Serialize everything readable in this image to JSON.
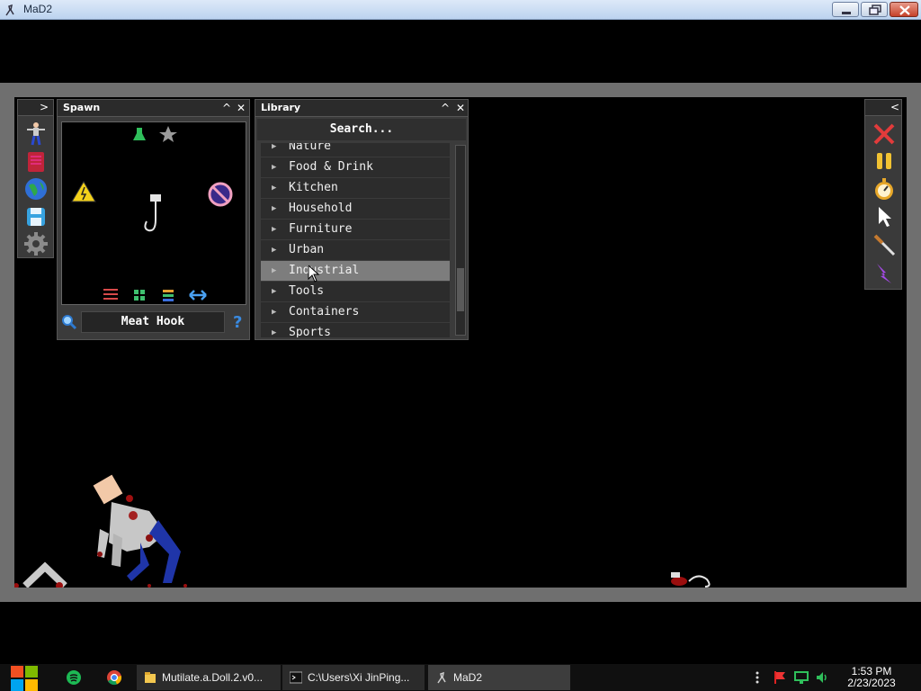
{
  "window": {
    "title": "MaD2"
  },
  "spawn_panel": {
    "title": "Spawn",
    "selected_item": "Meat Hook"
  },
  "library_panel": {
    "title": "Library",
    "search_placeholder": "Search...",
    "categories": [
      {
        "label": "Nature"
      },
      {
        "label": "Food & Drink"
      },
      {
        "label": "Kitchen"
      },
      {
        "label": "Household"
      },
      {
        "label": "Furniture"
      },
      {
        "label": "Urban"
      },
      {
        "label": "Industrial",
        "selected": true
      },
      {
        "label": "Tools"
      },
      {
        "label": "Containers"
      },
      {
        "label": "Sports"
      }
    ]
  },
  "left_toolbar": {
    "icons": [
      "ragdoll-icon",
      "book-icon",
      "globe-icon",
      "save-icon",
      "settings-gear-icon"
    ]
  },
  "right_toolbar": {
    "icons": [
      "clear-x-icon",
      "pause-icon",
      "stopwatch-icon",
      "cursor-icon",
      "knife-icon",
      "lightning-icon"
    ]
  },
  "taskbar": {
    "tasks": [
      {
        "label": "Mutilate.a.Doll.2.v0..."
      },
      {
        "label": "C:\\Users\\Xi JinPing..."
      },
      {
        "label": "MaD2"
      }
    ],
    "time": "1:53 PM",
    "date": "2/23/2023"
  },
  "colors": {
    "frame": "#6f6f6f",
    "panel": "#3b3b3b",
    "selected_row": "#7d7d7d",
    "close_red": "#e23b3b",
    "pause_yellow": "#f1c232"
  }
}
